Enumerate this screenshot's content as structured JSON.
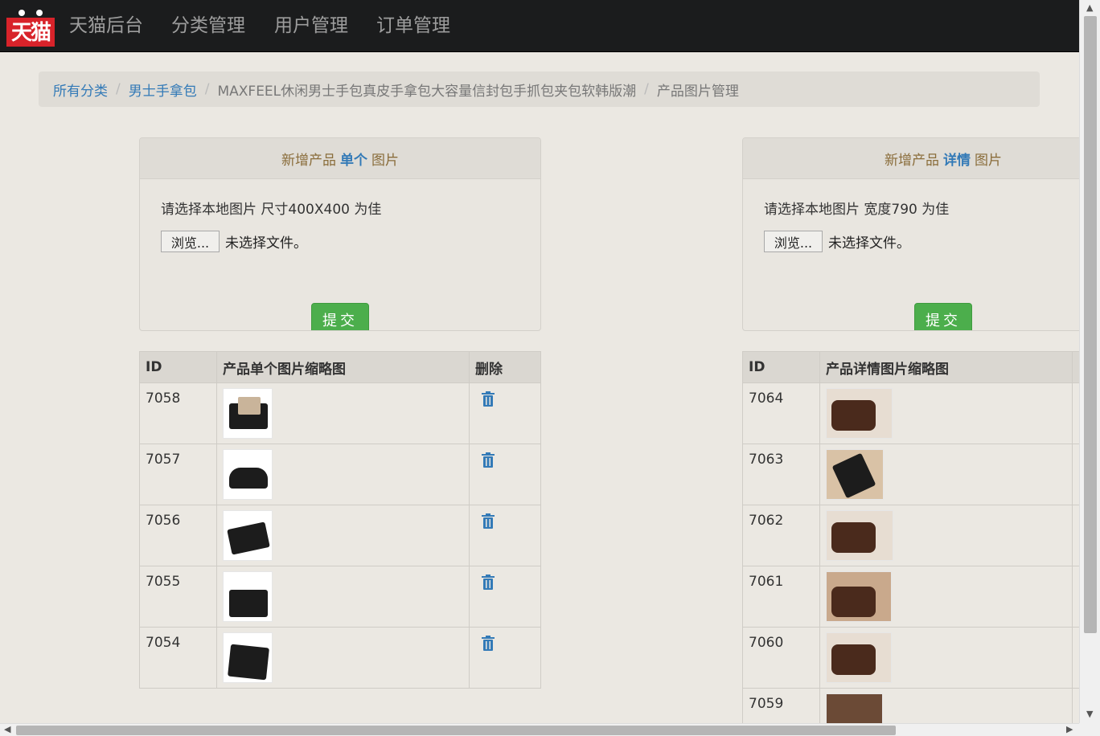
{
  "navbar": {
    "logo_text": "天猫",
    "brand": "天猫后台",
    "items": [
      "分类管理",
      "用户管理",
      "订单管理"
    ]
  },
  "breadcrumb": {
    "items": [
      "所有分类",
      "男士手拿包"
    ],
    "product": "MAXFEEL休闲男士手包真皮手拿包大容量信封包手抓包夹包软韩版潮",
    "current": "产品图片管理"
  },
  "single_panel": {
    "heading_prefix": "新增产品",
    "heading_highlight": "单个",
    "heading_suffix": "图片",
    "hint": "请选择本地图片 尺寸400X400 为佳",
    "browse_label": "浏览...",
    "no_file_text": "未选择文件。",
    "submit_label": "提交"
  },
  "detail_panel": {
    "heading_prefix": "新增产品",
    "heading_highlight": "详情",
    "heading_suffix": "图片",
    "hint": "请选择本地图片 宽度790 为佳",
    "browse_label": "浏览...",
    "no_file_text": "未选择文件。",
    "submit_label": "提交"
  },
  "single_table": {
    "headers": [
      "ID",
      "产品单个图片缩略图",
      "删除"
    ],
    "rows": [
      {
        "id": "7058",
        "thumb_icon": "bag-with-tablet-image"
      },
      {
        "id": "7057",
        "thumb_icon": "open-bag-image"
      },
      {
        "id": "7056",
        "thumb_icon": "black-clutch-image"
      },
      {
        "id": "7055",
        "thumb_icon": "black-envelope-bag-image"
      },
      {
        "id": "7054",
        "thumb_icon": "hand-holding-bag-image"
      }
    ],
    "delete_icon": "trash-icon"
  },
  "detail_table": {
    "headers": [
      "ID",
      "产品详情图片缩略图"
    ],
    "rows": [
      {
        "id": "7064",
        "thumb_icon": "brown-wallet-image"
      },
      {
        "id": "7063",
        "thumb_icon": "wallet-with-phone-image"
      },
      {
        "id": "7062",
        "thumb_icon": "brown-wallet-image"
      },
      {
        "id": "7061",
        "thumb_icon": "open-brown-wallet-image"
      },
      {
        "id": "7060",
        "thumb_icon": "brown-wallet-image"
      },
      {
        "id": "7059",
        "thumb_icon": "brown-wallet-image"
      }
    ]
  },
  "colors": {
    "navbar_bg": "#1b1c1d",
    "link": "#337ab7",
    "submit": "#4cae4c",
    "logo_red": "#d8232a"
  }
}
